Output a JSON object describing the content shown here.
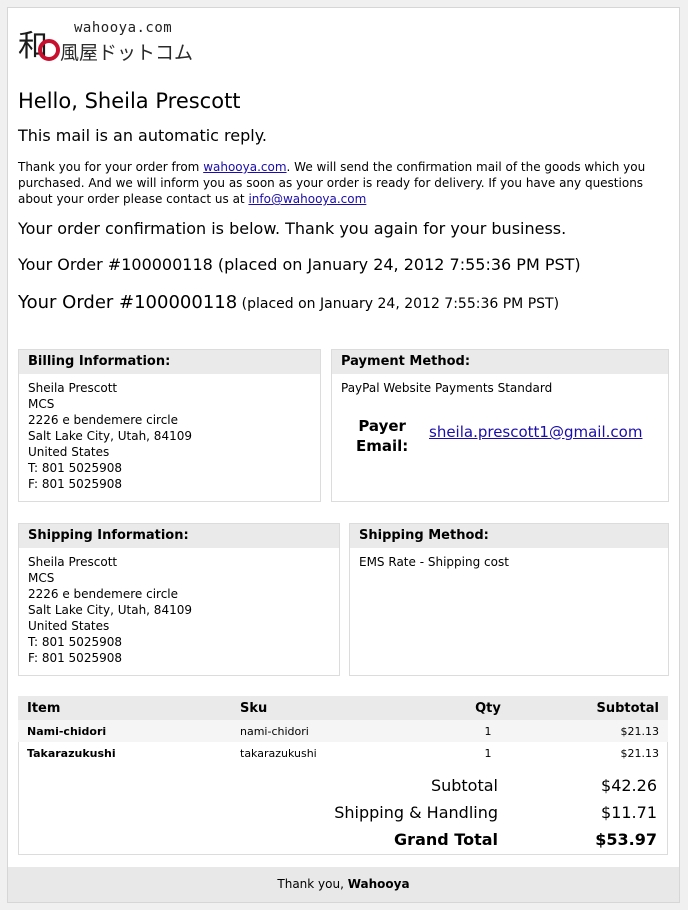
{
  "logo": {
    "domain": "wahooya.com",
    "japanese": "風屋ドットコム"
  },
  "greeting": "Hello, Sheila Prescott",
  "auto_reply": "This mail is an automatic reply.",
  "intro": {
    "before_link": "Thank you for your order from ",
    "link": "wahooya.com",
    "middle": ". We will send the confirmation mail of the goods which you purchased. And we will inform you as soon as your order is ready for delivery. If you have any questions about your order please contact us at ",
    "email": "info@wahooya.com"
  },
  "confirmation": "Your order confirmation is below. Thank you again for your business.",
  "order_line": "Your Order #100000118 (placed on January 24, 2012 7:55:36 PM PST)",
  "order_big": "Your Order #100000118",
  "order_small": " (placed on January 24, 2012 7:55:36 PM PST)",
  "billing": {
    "title": "Billing Information:",
    "lines": [
      "Sheila Prescott",
      "MCS",
      "2226 e bendemere circle",
      "Salt Lake City, Utah, 84109",
      "United States",
      "T: 801 5025908",
      "F: 801 5025908"
    ]
  },
  "payment": {
    "title": "Payment Method:",
    "method": "PayPal Website Payments Standard",
    "payer_label_1": "Payer",
    "payer_label_2": "Email:",
    "payer_email": "sheila.prescott1@gmail.com"
  },
  "shipping": {
    "title": "Shipping Information:",
    "lines": [
      "Sheila Prescott",
      "MCS",
      "2226 e bendemere circle",
      "Salt Lake City, Utah, 84109",
      "United States",
      "T: 801 5025908",
      "F: 801 5025908"
    ]
  },
  "shipping_method": {
    "title": "Shipping Method:",
    "method": "EMS Rate - Shipping cost"
  },
  "items": {
    "headers": [
      "Item",
      "Sku",
      "Qty",
      "Subtotal"
    ],
    "rows": [
      {
        "item": "Nami-chidori",
        "sku": "nami-chidori",
        "qty": "1",
        "subtotal": "$21.13"
      },
      {
        "item": "Takarazukushi",
        "sku": "takarazukushi",
        "qty": "1",
        "subtotal": "$21.13"
      }
    ]
  },
  "totals": {
    "subtotal_label": "Subtotal",
    "subtotal": "$42.26",
    "shipping_label": "Shipping & Handling",
    "shipping": "$11.71",
    "grand_label": "Grand Total",
    "grand": "$53.97"
  },
  "footer": {
    "prefix": "Thank you, ",
    "name": "Wahooya"
  },
  "colors": {
    "link": "#1a0dab",
    "header_bg": "#eaeaea",
    "logo_red": "#c8102e"
  }
}
